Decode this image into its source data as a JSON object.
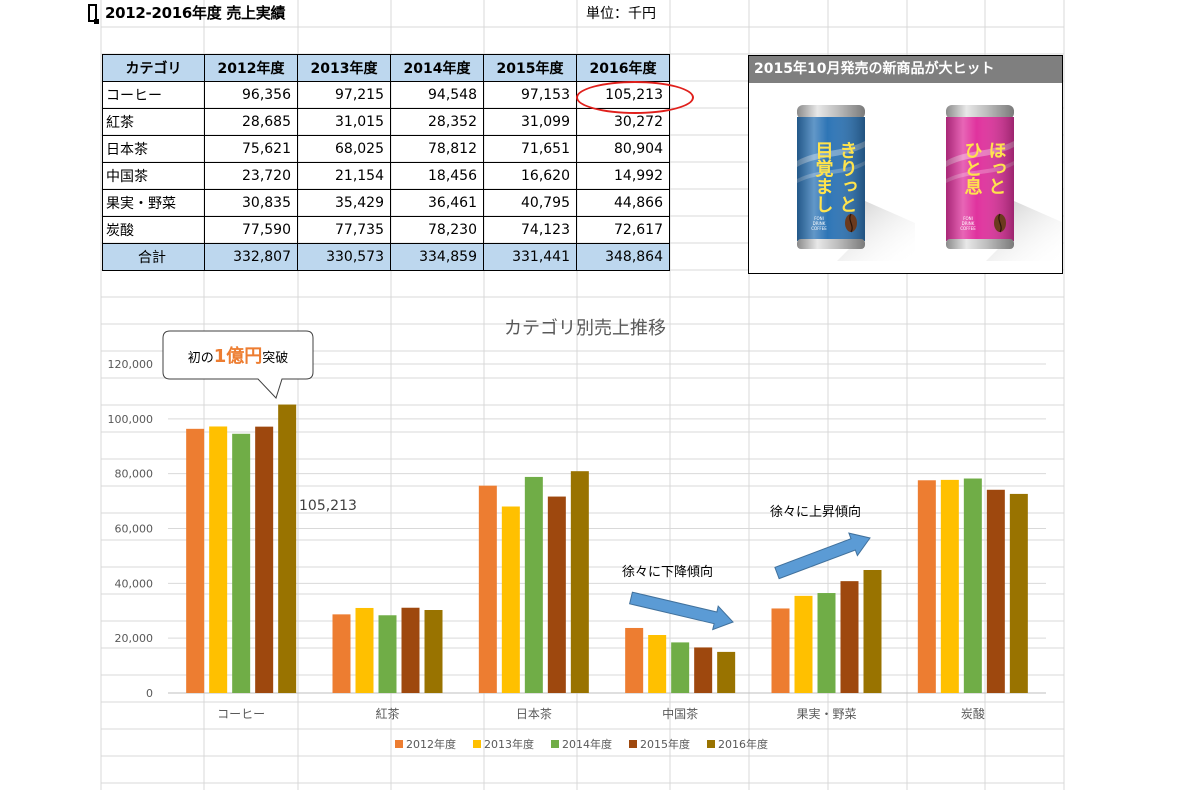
{
  "sheet": {
    "title": "2012-2016年度 売上実績",
    "unit_label": "単位：千円"
  },
  "table": {
    "headers": [
      "カテゴリ",
      "2012年度",
      "2013年度",
      "2014年度",
      "2015年度",
      "2016年度"
    ],
    "rows": [
      [
        "コーヒー",
        "96,356",
        "97,215",
        "94,548",
        "97,153",
        "105,213"
      ],
      [
        "紅茶",
        "28,685",
        "31,015",
        "28,352",
        "31,099",
        "30,272"
      ],
      [
        "日本茶",
        "75,621",
        "68,025",
        "78,812",
        "71,651",
        "80,904"
      ],
      [
        "中国茶",
        "23,720",
        "21,154",
        "18,456",
        "16,620",
        "14,992"
      ],
      [
        "果実・野菜",
        "30,835",
        "35,429",
        "36,461",
        "40,795",
        "44,866"
      ],
      [
        "炭酸",
        "77,590",
        "77,735",
        "78,230",
        "74,123",
        "72,617"
      ]
    ],
    "total": [
      "合計",
      "332,807",
      "330,573",
      "334,859",
      "331,441",
      "348,864"
    ],
    "highlight_color": "#e0201c",
    "header_fill": "#bdd7ee"
  },
  "product_box": {
    "title": "2015年10月発売の新商品が大ヒット",
    "cans": [
      {
        "text_lines": [
          "きりっと",
          "目覚まし"
        ],
        "color": "#2e75b6",
        "text_color": "#ffe34d"
      },
      {
        "text_lines": [
          "ほっと",
          "ひと息"
        ],
        "color": "#e0339e",
        "text_color": "#ffe34d"
      }
    ],
    "can_small_text": [
      "FONI",
      "DRINK",
      "COFFEE"
    ]
  },
  "chart_data": {
    "type": "bar",
    "title": "カテゴリ別売上推移",
    "categories": [
      "コーヒー",
      "紅茶",
      "日本茶",
      "中国茶",
      "果実・野菜",
      "炭酸"
    ],
    "series": [
      {
        "name": "2012年度",
        "color": "#ed7d31",
        "values": [
          96356,
          28685,
          75621,
          23720,
          30835,
          77590
        ]
      },
      {
        "name": "2013年度",
        "color": "#ffc000",
        "values": [
          97215,
          31015,
          68025,
          21154,
          35429,
          77735
        ]
      },
      {
        "name": "2014年度",
        "color": "#70ad47",
        "values": [
          94548,
          28352,
          78812,
          18456,
          36461,
          78230
        ]
      },
      {
        "name": "2015年度",
        "color": "#9e480e",
        "values": [
          97153,
          31099,
          71651,
          16620,
          40795,
          74123
        ]
      },
      {
        "name": "2016年度",
        "color": "#997300",
        "values": [
          105213,
          30272,
          80904,
          14992,
          44866,
          72617
        ]
      }
    ],
    "ylim": [
      0,
      120000
    ],
    "yticks": [
      0,
      20000,
      40000,
      60000,
      80000,
      100000,
      120000
    ],
    "ytick_labels": [
      "0",
      "20,000",
      "40,000",
      "60,000",
      "80,000",
      "100,000",
      "120,000"
    ],
    "grid": true,
    "legend": "bottom",
    "annotations": {
      "value_label": "105,213",
      "callout_prefix": "初の",
      "callout_emphasis": "1億円",
      "callout_suffix": "突破",
      "callout_emphasis_color": "#ed7d31",
      "down_trend": "徐々に下降傾向",
      "up_trend": "徐々に上昇傾向",
      "arrow_color": "#5b9bd5"
    }
  }
}
